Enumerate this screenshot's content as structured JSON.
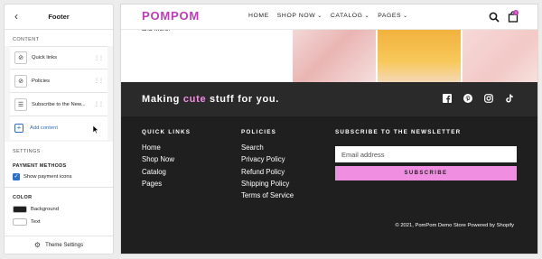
{
  "editor": {
    "title": "Footer",
    "content_label": "CONTENT",
    "blocks": [
      {
        "label": "Quick links"
      },
      {
        "label": "Policies"
      },
      {
        "label": "Subscribe to the New..."
      }
    ],
    "add_content": "Add content",
    "settings_label": "SETTINGS",
    "payment_methods_label": "PAYMENT METHODS",
    "show_payment_icons": "Show payment icons",
    "show_payment_icons_checked": true,
    "color_label": "COLOR",
    "colors": [
      {
        "label": "Background",
        "value": "#1f1f1f"
      },
      {
        "label": "Text",
        "value": "#ffffff"
      }
    ],
    "theme_settings": "Theme Settings"
  },
  "store": {
    "logo": "POMPOM",
    "nav": [
      {
        "label": "HOME",
        "has_dropdown": false
      },
      {
        "label": "SHOP NOW",
        "has_dropdown": true
      },
      {
        "label": "CATALOG",
        "has_dropdown": true
      },
      {
        "label": "PAGES",
        "has_dropdown": true
      }
    ],
    "cart_count": "1",
    "hero_text": "and more!",
    "accent_color": "#f08ee1",
    "logo_color": "#c13ab9"
  },
  "footer": {
    "tagline_pre": "Making ",
    "tagline_accent": "cute",
    "tagline_post": " stuff for you.",
    "social_icons": [
      "facebook-icon",
      "pinterest-icon",
      "instagram-icon",
      "tiktok-icon"
    ],
    "quick_links_title": "QUICK LINKS",
    "quick_links": [
      "Home",
      "Shop Now",
      "Catalog",
      "Pages"
    ],
    "policies_title": "POLICIES",
    "policies": [
      "Search",
      "Privacy Policy",
      "Refund Policy",
      "Shipping Policy",
      "Terms of Service"
    ],
    "newsletter_title": "SUBSCRIBE TO THE NEWSLETTER",
    "email_placeholder": "Email address",
    "subscribe_label": "SUBSCRIBE",
    "copyright": "© 2021, PomPom Demo Store Powered by Shopify"
  }
}
